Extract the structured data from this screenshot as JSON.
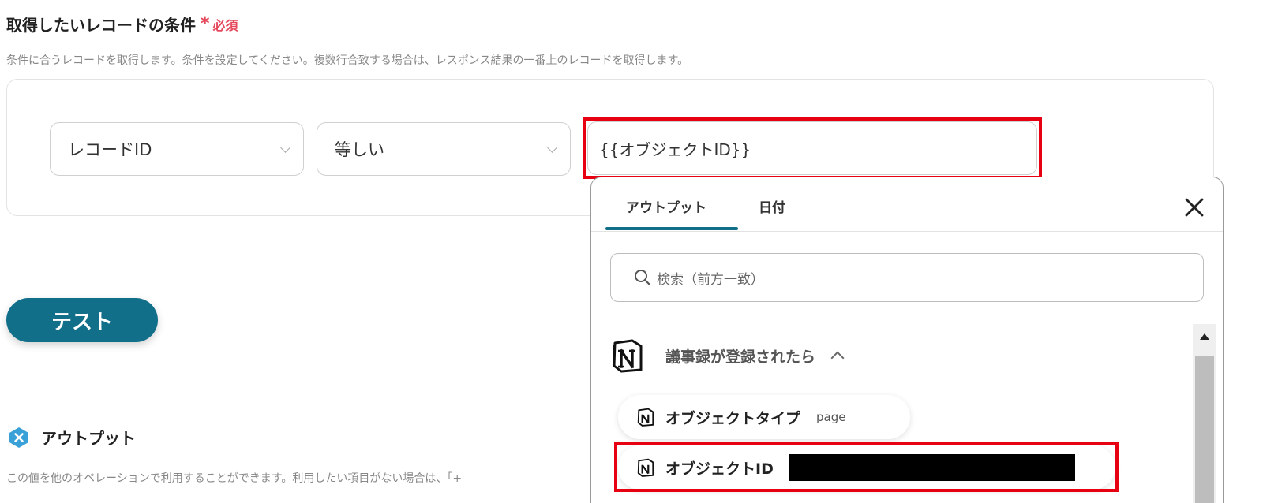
{
  "section": {
    "title": "取得したいレコードの条件",
    "required_star": "*",
    "required_label": "必須",
    "description": "条件に合うレコードを取得します。条件を設定してください。複数行合致する場合は、レスポンス結果の一番上のレコードを取得します。"
  },
  "condition": {
    "field_value": "レコードID",
    "operator_value": "等しい",
    "input_value": "{{オブジェクトID}}"
  },
  "test_button_label": "テスト",
  "output_section": {
    "title": "アウトプット",
    "description": "この値を他のオペレーションで利用することができます。利用したい項目がない場合は、「+"
  },
  "popup": {
    "tabs": [
      {
        "label": "アウトプット",
        "active": true
      },
      {
        "label": "日付",
        "active": false
      }
    ],
    "search_placeholder": "検索（前方一致）",
    "group": {
      "title": "議事録が登録されたら",
      "icon": "notion-icon",
      "expanded": true
    },
    "items": [
      {
        "name": "オブジェクトタイプ",
        "value": "page"
      },
      {
        "name": "オブジェクトID",
        "value": ""
      }
    ]
  },
  "colors": {
    "accent": "#116f8a",
    "required": "#e5475b",
    "highlight": "#e60012"
  }
}
